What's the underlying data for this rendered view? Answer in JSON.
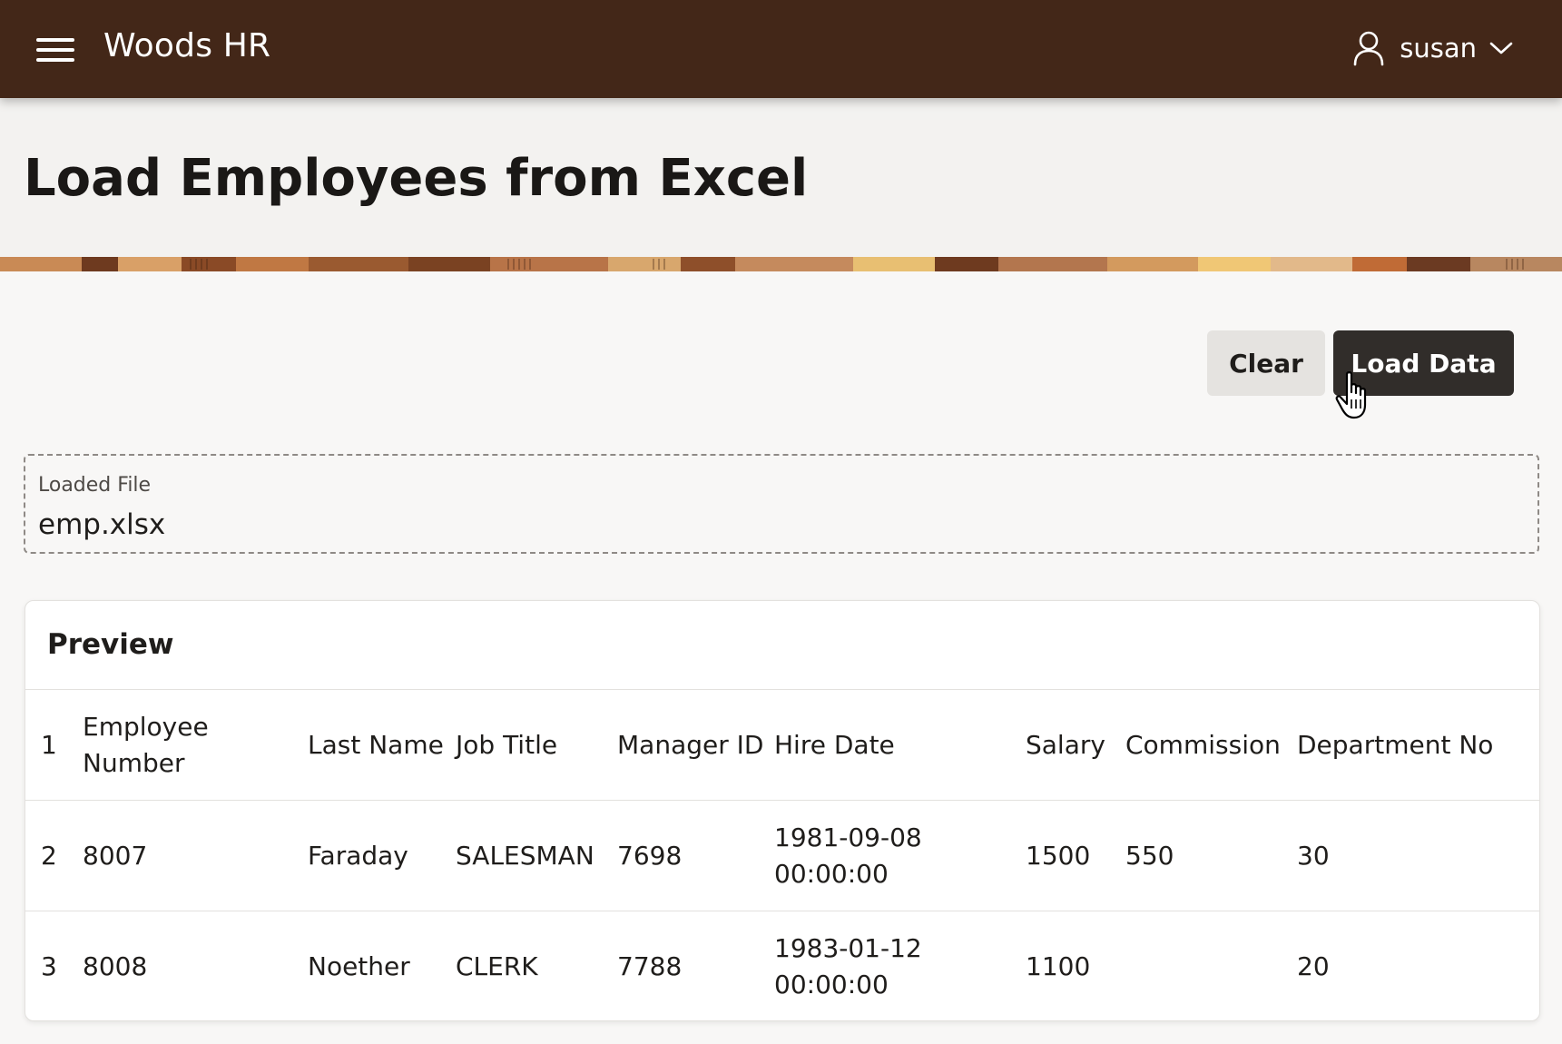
{
  "header": {
    "app_title": "Woods HR",
    "user_name": "susan"
  },
  "page": {
    "title": "Load Employees from Excel"
  },
  "actions": {
    "clear_label": "Clear",
    "load_label": "Load Data"
  },
  "loaded_file": {
    "label": "Loaded File",
    "value": "emp.xlsx"
  },
  "preview": {
    "title": "Preview",
    "header_row": {
      "line": "1",
      "cols": [
        "Employee Number",
        "Last Name",
        "Job Title",
        "Manager ID",
        "Hire Date",
        "Salary",
        "Commission",
        "Department No"
      ]
    },
    "rows": [
      {
        "line": "2",
        "cells": [
          "8007",
          "Faraday",
          "SALESMAN",
          "7698",
          "1981-09-08 00:00:00",
          "1500",
          "550",
          "30"
        ]
      },
      {
        "line": "3",
        "cells": [
          "8008",
          "Noether",
          "CLERK",
          "7788",
          "1983-01-12 00:00:00",
          "1100",
          "",
          "20"
        ]
      }
    ]
  },
  "colors": {
    "header_bg": "#432718",
    "primary_button": "#312d2a",
    "secondary_button": "#e5e3e0"
  },
  "icons": {
    "menu": "hamburger-icon",
    "user": "user-icon",
    "dropdown": "chevron-down-icon",
    "cursor": "hand-pointer-icon"
  }
}
